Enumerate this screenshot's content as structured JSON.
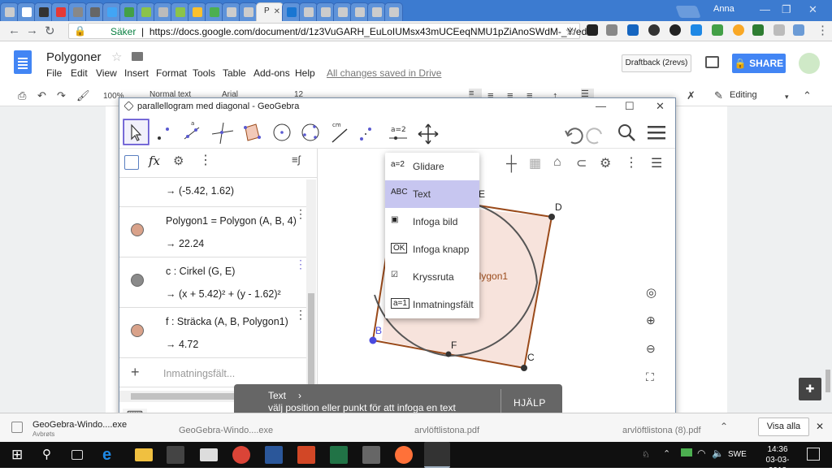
{
  "browser": {
    "user": "Anna",
    "tab_colors": [
      "#cccccc",
      "#ffffff",
      "#333333",
      "#e53935",
      "#888888",
      "#666666",
      "#42a5f5",
      "#43a047",
      "#8bc34a",
      "#bbbbbb",
      "#8bc34a",
      "#fbc02d",
      "#4caf50",
      "#cccccc",
      "#cccccc",
      "#cccccc",
      "#1976d2",
      "#cccccc",
      "#cccccc",
      "#cccccc",
      "#cccccc",
      "#cccccc",
      "#cccccc"
    ],
    "active_tab_label": "P",
    "secure_label": "Säker",
    "url": "https://docs.google.com/document/d/1z3VuGARH_EuLoIUMsx43mUCEeqNMU1pZiAnoSWdM-_Y/edit#"
  },
  "docs": {
    "title": "Polygoner",
    "menus": [
      "File",
      "Edit",
      "View",
      "Insert",
      "Format",
      "Tools",
      "Table",
      "Add-ons",
      "Help"
    ],
    "save_status": "All changes saved in Drive",
    "draftback": "Draftback (2revs)",
    "share": "SHARE",
    "zoom": "100%",
    "style": "Normal text",
    "font": "Arial",
    "size": "12",
    "editing": "Editing"
  },
  "geogebra": {
    "title": "parallellogram med diagonal - GeoGebra",
    "algebra": {
      "rows": [
        {
          "def": "",
          "val": "→  (-5.42, 1.62)",
          "color": ""
        },
        {
          "def": "Polygon1 = Polygon (A, B, 4)",
          "val": "→  22.24",
          "color": "#d9a28a"
        },
        {
          "def": "c : Cirkel (G, E)",
          "val": "→  (x + 5.42)² + (y - 1.62)²",
          "color": "#888888"
        },
        {
          "def": "f : Sträcka (A, B, Polygon1)",
          "val": "→  4.72",
          "color": "#d9a28a"
        }
      ],
      "input_placeholder": "Inmatningsfält..."
    },
    "menu": [
      {
        "icon": "a=2",
        "label": "Glidare"
      },
      {
        "icon": "ABC",
        "label": "Text"
      },
      {
        "icon": "▣",
        "label": "Infoga bild"
      },
      {
        "icon": "OK",
        "label": "Infoga knapp"
      },
      {
        "icon": "☑",
        "label": "Kryssruta"
      },
      {
        "icon": "a=1",
        "label": "Inmatningsfält"
      }
    ],
    "points": {
      "E": "E",
      "D": "D",
      "B": "B",
      "F": "F",
      "C": "C",
      "polygon": "Polygon1"
    },
    "toast": {
      "title": "Text",
      "body": "välj position eller punkt för att infoga en text",
      "help": "HJÄLP"
    },
    "colors": {
      "accent": "#6557d2",
      "polygon_fill": "#f7e3dc",
      "polygon_edge": "#9a4a1a"
    }
  },
  "downloads": {
    "file1": "GeoGebra-Windo....exe",
    "file1_status": "Avbrøts",
    "file2": "GeoGebra-Windo....exe",
    "file3": "arvlöftlistona.pdf",
    "file4": "arvlöftlistona (8).pdf",
    "show_all": "Visa alla"
  },
  "taskbar": {
    "lang": "SWE",
    "time": "14:36",
    "date": "03-03-2018"
  }
}
